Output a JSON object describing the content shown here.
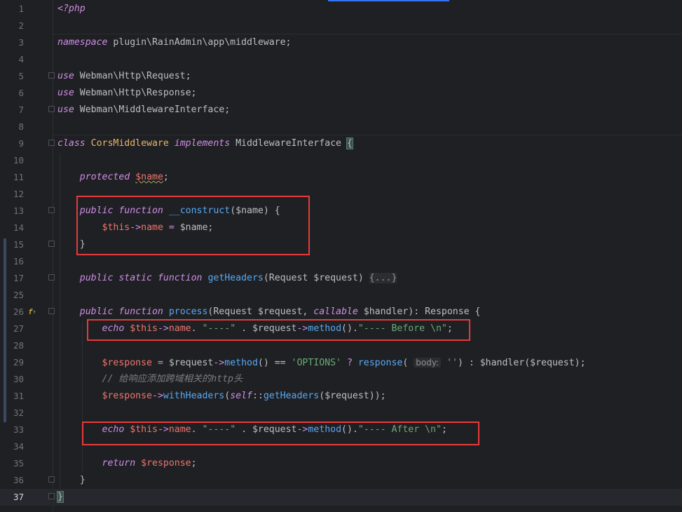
{
  "editor": {
    "current_line": "37",
    "lines": [
      {
        "n": "1",
        "tokens": [
          {
            "t": "<?php",
            "c": "kw"
          }
        ]
      },
      {
        "n": "2",
        "tokens": []
      },
      {
        "n": "3",
        "tokens": [
          {
            "t": "namespace",
            "c": "kw"
          },
          {
            "t": " plugin\\RainAdmin\\app\\middleware;",
            "c": "plain"
          }
        ]
      },
      {
        "n": "4",
        "tokens": []
      },
      {
        "n": "5",
        "tokens": [
          {
            "t": "use",
            "c": "kw"
          },
          {
            "t": " Webman\\Http\\Request;",
            "c": "plain"
          }
        ]
      },
      {
        "n": "6",
        "tokens": [
          {
            "t": "use",
            "c": "kw"
          },
          {
            "t": " Webman\\Http\\Response;",
            "c": "plain"
          }
        ]
      },
      {
        "n": "7",
        "tokens": [
          {
            "t": "use",
            "c": "kw"
          },
          {
            "t": " Webman\\MiddlewareInterface;",
            "c": "plain"
          }
        ]
      },
      {
        "n": "8",
        "tokens": []
      },
      {
        "n": "9",
        "tokens": [
          {
            "t": "class",
            "c": "kw"
          },
          {
            "t": " ",
            "c": "plain"
          },
          {
            "t": "CorsMiddleware",
            "c": "cls"
          },
          {
            "t": " ",
            "c": "plain"
          },
          {
            "t": "implements",
            "c": "kw"
          },
          {
            "t": " MiddlewareInterface ",
            "c": "plain"
          },
          {
            "t": "{",
            "c": "brace-hl"
          }
        ]
      },
      {
        "n": "10",
        "tokens": []
      },
      {
        "n": "11",
        "tokens": [
          {
            "t": "    ",
            "c": "plain"
          },
          {
            "t": "protected",
            "c": "kw"
          },
          {
            "t": " ",
            "c": "plain"
          },
          {
            "t": "$name",
            "c": "var squig"
          },
          {
            "t": ";",
            "c": "plain"
          }
        ]
      },
      {
        "n": "12",
        "tokens": []
      },
      {
        "n": "13",
        "tokens": [
          {
            "t": "    ",
            "c": "plain"
          },
          {
            "t": "public",
            "c": "kw"
          },
          {
            "t": " ",
            "c": "plain"
          },
          {
            "t": "function",
            "c": "kw"
          },
          {
            "t": " ",
            "c": "plain"
          },
          {
            "t": "__construct",
            "c": "fn"
          },
          {
            "t": "($name) {",
            "c": "plain"
          }
        ]
      },
      {
        "n": "14",
        "tokens": [
          {
            "t": "        ",
            "c": "plain"
          },
          {
            "t": "$this",
            "c": "var"
          },
          {
            "t": "->",
            "c": "op"
          },
          {
            "t": "name",
            "c": "var"
          },
          {
            "t": " = ",
            "c": "op"
          },
          {
            "t": "$name;",
            "c": "plain"
          }
        ]
      },
      {
        "n": "15",
        "tokens": [
          {
            "t": "    }",
            "c": "plain"
          }
        ]
      },
      {
        "n": "16",
        "tokens": []
      },
      {
        "n": "17",
        "tokens": [
          {
            "t": "    ",
            "c": "plain"
          },
          {
            "t": "public",
            "c": "kw"
          },
          {
            "t": " ",
            "c": "plain"
          },
          {
            "t": "static",
            "c": "kw"
          },
          {
            "t": " ",
            "c": "plain"
          },
          {
            "t": "function",
            "c": "kw"
          },
          {
            "t": " ",
            "c": "plain"
          },
          {
            "t": "getHeaders",
            "c": "fn"
          },
          {
            "t": "(Request $request) ",
            "c": "plain"
          },
          {
            "t": "{...}",
            "c": "fold-text"
          }
        ]
      },
      {
        "n": "25",
        "tokens": []
      },
      {
        "n": "26",
        "tokens": [
          {
            "t": "    ",
            "c": "plain"
          },
          {
            "t": "public",
            "c": "kw"
          },
          {
            "t": " ",
            "c": "plain"
          },
          {
            "t": "function",
            "c": "kw"
          },
          {
            "t": " ",
            "c": "plain"
          },
          {
            "t": "process",
            "c": "fn"
          },
          {
            "t": "(Request $request, ",
            "c": "plain"
          },
          {
            "t": "callable",
            "c": "kw"
          },
          {
            "t": " $handler): Response {",
            "c": "plain"
          }
        ]
      },
      {
        "n": "27",
        "tokens": [
          {
            "t": "        ",
            "c": "plain"
          },
          {
            "t": "echo",
            "c": "kw"
          },
          {
            "t": " ",
            "c": "plain"
          },
          {
            "t": "$this",
            "c": "var"
          },
          {
            "t": "->",
            "c": "op"
          },
          {
            "t": "name",
            "c": "var"
          },
          {
            "t": ". ",
            "c": "plain"
          },
          {
            "t": "\"----\"",
            "c": "str"
          },
          {
            "t": " . $request",
            "c": "plain"
          },
          {
            "t": "->",
            "c": "op"
          },
          {
            "t": "method",
            "c": "fn"
          },
          {
            "t": "().",
            "c": "plain"
          },
          {
            "t": "\"---- Before \\n\"",
            "c": "str"
          },
          {
            "t": ";",
            "c": "plain"
          }
        ]
      },
      {
        "n": "28",
        "tokens": []
      },
      {
        "n": "29",
        "tokens": [
          {
            "t": "        ",
            "c": "plain"
          },
          {
            "t": "$response",
            "c": "var"
          },
          {
            "t": " = ",
            "c": "op"
          },
          {
            "t": "$request",
            "c": "plain"
          },
          {
            "t": "->",
            "c": "op"
          },
          {
            "t": "method",
            "c": "fn"
          },
          {
            "t": "() == ",
            "c": "plain"
          },
          {
            "t": "'OPTIONS'",
            "c": "str"
          },
          {
            "t": " ? ",
            "c": "op"
          },
          {
            "t": "response",
            "c": "fn"
          },
          {
            "t": "( ",
            "c": "plain"
          },
          {
            "t": "body:",
            "c": "hint"
          },
          {
            "t": " ",
            "c": "plain"
          },
          {
            "t": "''",
            "c": "str"
          },
          {
            "t": ") : $handler($request);",
            "c": "plain"
          }
        ]
      },
      {
        "n": "30",
        "tokens": [
          {
            "t": "        ",
            "c": "plain"
          },
          {
            "t": "// 给响应添加跨域相关的http头",
            "c": "cmt"
          }
        ]
      },
      {
        "n": "31",
        "tokens": [
          {
            "t": "        ",
            "c": "plain"
          },
          {
            "t": "$response",
            "c": "var"
          },
          {
            "t": "->",
            "c": "op"
          },
          {
            "t": "withHeaders",
            "c": "fn"
          },
          {
            "t": "(",
            "c": "plain"
          },
          {
            "t": "self",
            "c": "kw"
          },
          {
            "t": "::",
            "c": "plain"
          },
          {
            "t": "getHeaders",
            "c": "fn"
          },
          {
            "t": "($request));",
            "c": "plain"
          }
        ]
      },
      {
        "n": "32",
        "tokens": []
      },
      {
        "n": "33",
        "tokens": [
          {
            "t": "        ",
            "c": "plain"
          },
          {
            "t": "echo",
            "c": "kw"
          },
          {
            "t": " ",
            "c": "plain"
          },
          {
            "t": "$this",
            "c": "var"
          },
          {
            "t": "->",
            "c": "op"
          },
          {
            "t": "name",
            "c": "var"
          },
          {
            "t": ". ",
            "c": "plain"
          },
          {
            "t": "\"----\"",
            "c": "str"
          },
          {
            "t": " . $request",
            "c": "plain"
          },
          {
            "t": "->",
            "c": "op"
          },
          {
            "t": "method",
            "c": "fn"
          },
          {
            "t": "().",
            "c": "plain"
          },
          {
            "t": "\"---- After \\n\"",
            "c": "str"
          },
          {
            "t": ";",
            "c": "plain"
          }
        ]
      },
      {
        "n": "34",
        "tokens": []
      },
      {
        "n": "35",
        "tokens": [
          {
            "t": "        ",
            "c": "plain"
          },
          {
            "t": "return",
            "c": "kw"
          },
          {
            "t": " ",
            "c": "plain"
          },
          {
            "t": "$response",
            "c": "var"
          },
          {
            "t": ";",
            "c": "plain"
          }
        ]
      },
      {
        "n": "36",
        "tokens": [
          {
            "t": "    }",
            "c": "plain"
          }
        ]
      },
      {
        "n": "37",
        "tokens": [
          {
            "t": "}",
            "c": "brace-hl"
          }
        ]
      }
    ],
    "gutter_icon": "override-method-icon",
    "gutter_icon_glyph": "f",
    "colors": {
      "background": "#1f2023",
      "keyword": "#cf8ee8",
      "class": "#e8b66a",
      "variable": "#f0756f",
      "function": "#57a8f5",
      "string": "#6aab73",
      "comment": "#7a7e85",
      "annotation_box": "#e83a3a"
    }
  }
}
